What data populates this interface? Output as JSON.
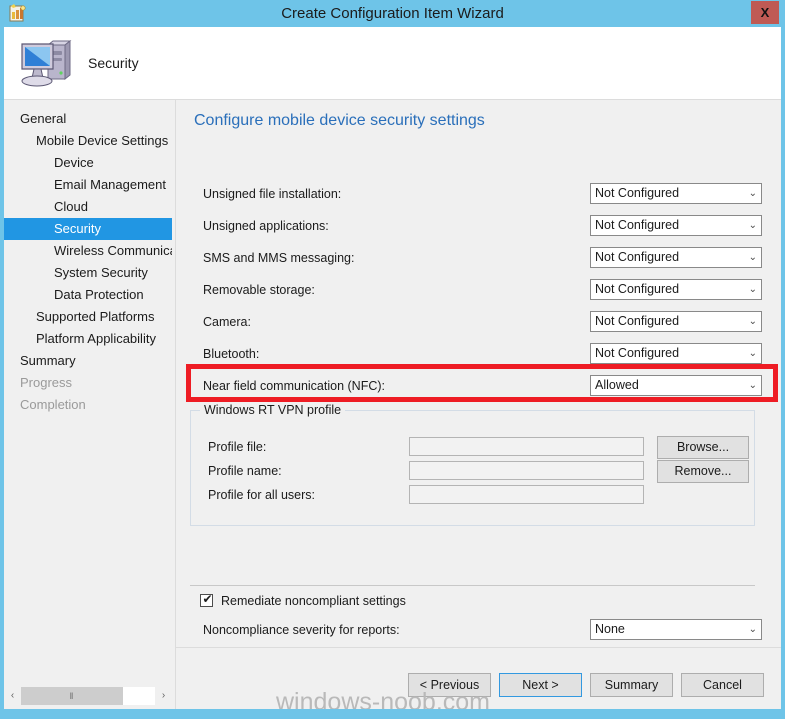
{
  "window": {
    "title": "Create Configuration Item Wizard",
    "close_label": "X",
    "app_icon": "wizard-icon",
    "frame_color": "#6ec4e8"
  },
  "header": {
    "title": "Security",
    "icon": "computer-icon"
  },
  "sidebar": {
    "items": [
      {
        "label": "General",
        "level": 0,
        "selected": false,
        "disabled": false
      },
      {
        "label": "Mobile Device Settings",
        "level": 1,
        "selected": false,
        "disabled": false
      },
      {
        "label": "Device",
        "level": 2,
        "selected": false,
        "disabled": false
      },
      {
        "label": "Email Management",
        "level": 2,
        "selected": false,
        "disabled": false
      },
      {
        "label": "Cloud",
        "level": 2,
        "selected": false,
        "disabled": false
      },
      {
        "label": "Security",
        "level": 2,
        "selected": true,
        "disabled": false
      },
      {
        "label": "Wireless Communicat",
        "level": 2,
        "selected": false,
        "disabled": false
      },
      {
        "label": "System Security",
        "level": 2,
        "selected": false,
        "disabled": false
      },
      {
        "label": "Data Protection",
        "level": 2,
        "selected": false,
        "disabled": false
      },
      {
        "label": "Supported Platforms",
        "level": 1,
        "selected": false,
        "disabled": false
      },
      {
        "label": "Platform Applicability",
        "level": 1,
        "selected": false,
        "disabled": false
      },
      {
        "label": "Summary",
        "level": 0,
        "selected": false,
        "disabled": false
      },
      {
        "label": "Progress",
        "level": 0,
        "selected": false,
        "disabled": true
      },
      {
        "label": "Completion",
        "level": 0,
        "selected": false,
        "disabled": true
      }
    ],
    "selected_color": "#2196e3",
    "scrollbar": {
      "left_arrow": "‹",
      "right_arrow": "›",
      "thumb_grip": "‖"
    }
  },
  "content": {
    "heading": "Configure mobile device security settings",
    "settings": [
      {
        "label": "Unsigned file installation:",
        "value": "Not Configured"
      },
      {
        "label": "Unsigned applications:",
        "value": "Not Configured"
      },
      {
        "label": "SMS and MMS messaging:",
        "value": "Not Configured"
      },
      {
        "label": "Removable storage:",
        "value": "Not Configured"
      },
      {
        "label": "Camera:",
        "value": "Not Configured"
      },
      {
        "label": "Bluetooth:",
        "value": "Not Configured"
      },
      {
        "label": "Near field communication (NFC):",
        "value": "Allowed",
        "highlighted": true
      }
    ],
    "highlight_color": "#ee1c24",
    "chevron": "⌄",
    "vpn_group": {
      "title": "Windows RT VPN profile",
      "rows": [
        {
          "label": "Profile file:",
          "value": "",
          "button": "Browse..."
        },
        {
          "label": "Profile name:",
          "value": "",
          "button": "Remove..."
        },
        {
          "label": "Profile for all users:",
          "value": "",
          "button": ""
        }
      ]
    },
    "compliance": {
      "remediate_label": "Remediate noncompliant settings",
      "remediate_checked": true,
      "check_glyph": "✔",
      "severity_label": "Noncompliance severity for reports:",
      "severity_value": "None"
    }
  },
  "footer": {
    "buttons": [
      {
        "label": "< Previous",
        "focused": false
      },
      {
        "label": "Next >",
        "focused": true
      },
      {
        "label": "Summary",
        "focused": false
      },
      {
        "label": "Cancel",
        "focused": false
      }
    ]
  },
  "watermark": "windows-noob.com"
}
